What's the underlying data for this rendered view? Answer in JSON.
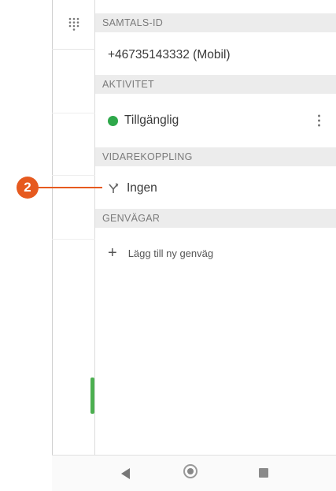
{
  "sections": {
    "call_id": {
      "header": "SAMTALS-ID",
      "value": "+46735143332 (Mobil)"
    },
    "activity": {
      "header": "AKTIVITET",
      "status": "Tillgänglig",
      "status_color": "#2ea84a"
    },
    "forwarding": {
      "header": "VIDAREKOPPLING",
      "value": "Ingen"
    },
    "shortcuts": {
      "header": "GENVÄGAR",
      "add_label": "Lägg till ny genväg"
    }
  },
  "callout": {
    "number": "2",
    "color": "#e65a1f"
  },
  "icons": {
    "dialpad": "dialpad-icon",
    "more": "more-vertical-icon",
    "forward": "call-forward-icon",
    "add": "plus-icon",
    "back": "back-icon",
    "home": "home-icon",
    "recents": "recents-icon"
  }
}
